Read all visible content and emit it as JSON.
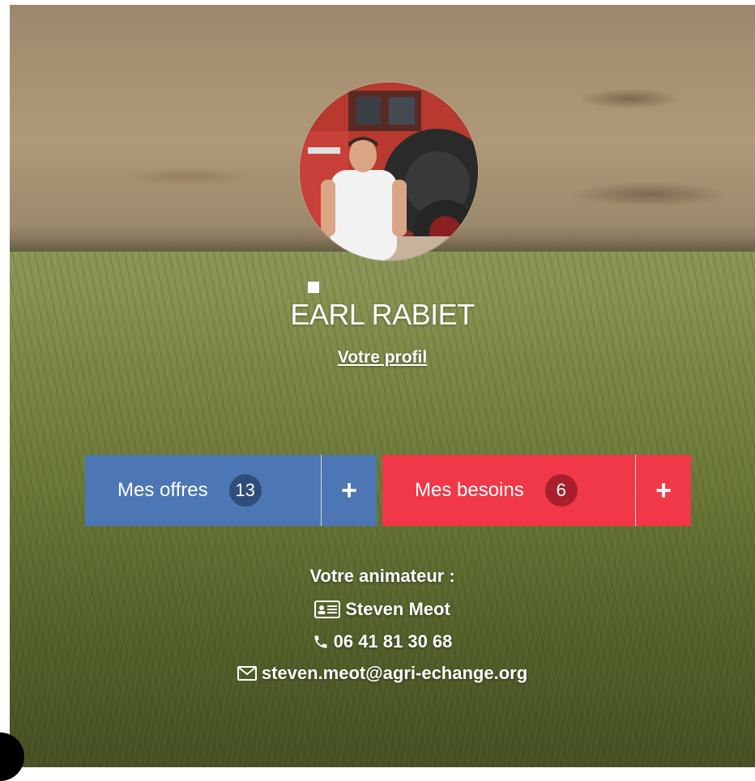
{
  "profile": {
    "org_name": "EARL RABIET",
    "profile_link": "Votre profil"
  },
  "buttons": {
    "offres": {
      "label": "Mes offres",
      "count": "13",
      "add": "+"
    },
    "besoins": {
      "label": "Mes besoins",
      "count": "6",
      "add": "+"
    }
  },
  "contact": {
    "title": "Votre animateur :",
    "name": "Steven Meot",
    "phone": "06 41 81 30 68",
    "email": "steven.meot@agri-echange.org"
  },
  "colors": {
    "offres": "#4c77b4",
    "besoins": "#f03848",
    "text": "#ffffff"
  },
  "icons": {
    "name": "id-card-icon",
    "phone": "phone-icon",
    "email": "envelope-icon",
    "add": "plus-icon"
  }
}
